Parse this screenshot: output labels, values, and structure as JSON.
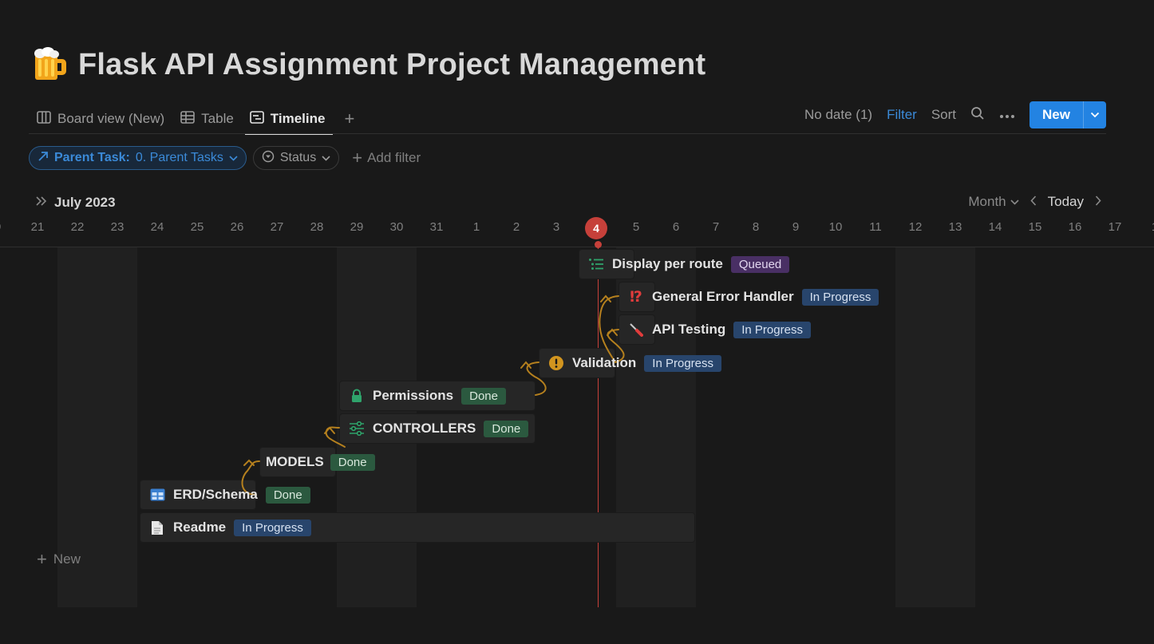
{
  "page": {
    "title": "Flask API Assignment Project Management",
    "icon": "beer-mug-icon"
  },
  "tabs": [
    {
      "label": "Board view (New)",
      "icon": "board-icon",
      "active": false
    },
    {
      "label": "Table",
      "icon": "table-icon",
      "active": false
    },
    {
      "label": "Timeline",
      "icon": "timeline-icon",
      "active": true
    }
  ],
  "toolbar": {
    "no_date": "No date (1)",
    "filter": "Filter",
    "sort": "Sort",
    "new": "New"
  },
  "filters": {
    "parent_label": "Parent Task:",
    "parent_value": "0. Parent Tasks",
    "status": "Status",
    "add_filter": "Add filter"
  },
  "timeline": {
    "month": "July 2023",
    "view": "Month",
    "today": "Today",
    "days": [
      "0",
      "21",
      "22",
      "23",
      "24",
      "25",
      "26",
      "27",
      "28",
      "29",
      "30",
      "31",
      "1",
      "2",
      "3",
      "4",
      "5",
      "6",
      "7",
      "8",
      "9",
      "10",
      "11",
      "12",
      "13",
      "14",
      "15",
      "16",
      "17",
      "1"
    ],
    "today_day": "4"
  },
  "tasks": [
    {
      "name": "Display per route",
      "status": "Queued",
      "icon": "list-icon"
    },
    {
      "name": "General Error Handler",
      "status": "In Progress",
      "icon": "exclamation-question-icon"
    },
    {
      "name": "API Testing",
      "status": "In Progress",
      "icon": "screwdriver-icon"
    },
    {
      "name": "Validation",
      "status": "In Progress",
      "icon": "warning-icon"
    },
    {
      "name": "Permissions",
      "status": "Done",
      "icon": "lock-icon"
    },
    {
      "name": "CONTROLLERS",
      "status": "Done",
      "icon": "sliders-icon"
    },
    {
      "name": "MODELS",
      "status": "Done",
      "icon": ""
    },
    {
      "name": "ERD/Schema",
      "status": "Done",
      "icon": "table-grid-icon"
    },
    {
      "name": "Readme",
      "status": "In Progress",
      "icon": "document-icon"
    }
  ],
  "new_row": "New",
  "colors": {
    "accent": "#2383e2",
    "today": "#c6403a",
    "dependency": "#b5801e",
    "done": "#2b593f",
    "in_progress": "#28456c",
    "queued": "#492f64"
  }
}
